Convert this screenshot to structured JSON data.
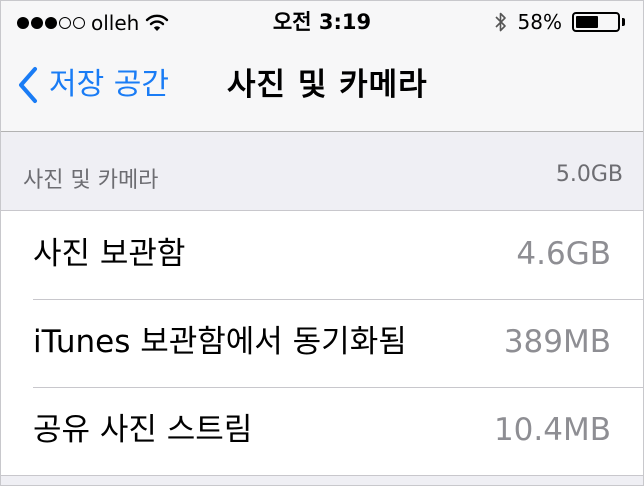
{
  "status_bar": {
    "carrier": "olleh",
    "signal_bars_filled": 3,
    "signal_bars_total": 5,
    "time": "오전 3:19",
    "battery_percent": "58%",
    "battery_level": 0.58
  },
  "nav": {
    "back_label": "저장 공간",
    "title": "사진 및 카메라"
  },
  "section": {
    "label": "사진 및 카메라",
    "value": "5.0GB"
  },
  "items": [
    {
      "label": "사진 보관함",
      "value": "4.6GB"
    },
    {
      "label": "iTunes 보관함에서 동기화됨",
      "value": "389MB"
    },
    {
      "label": "공유 사진 스트림",
      "value": "10.4MB"
    }
  ],
  "colors": {
    "accent": "#1a7cf5",
    "background": "#efeff4",
    "secondary_text": "#8e8e93"
  }
}
